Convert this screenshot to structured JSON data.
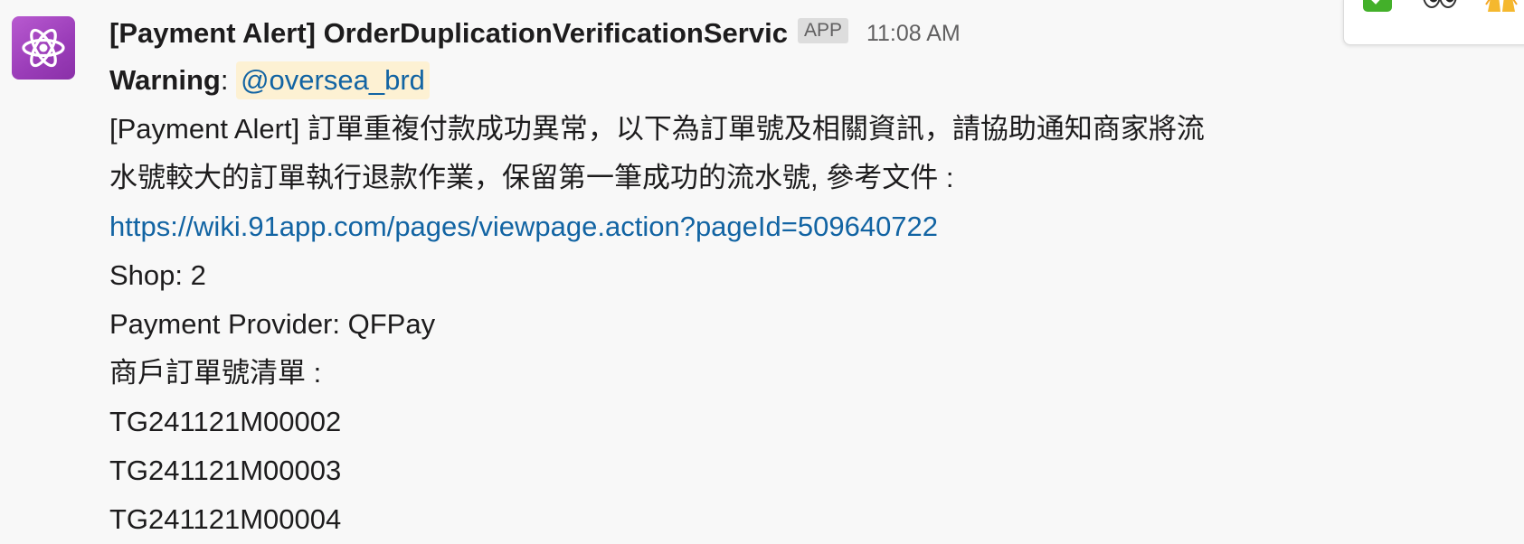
{
  "message": {
    "sender": "[Payment Alert] OrderDuplicationVerificationServic",
    "badge": "APP",
    "timestamp": "11:08 AM",
    "warning_label": "Warning",
    "mention": "@oversea_brd",
    "alert_line_1": "[Payment Alert] 訂單重複付款成功異常，以下為訂單號及相關資訊，請協助通知商家將流",
    "alert_line_2": "水號較大的訂單執行退款作業，保留第一筆成功的流水號, 參考文件 :",
    "link": "https://wiki.91app.com/pages/viewpage.action?pageId=509640722",
    "shop": "Shop: 2",
    "payment_provider": "Payment Provider: QFPay",
    "order_list_label": "商戶訂單號清單 :",
    "orders": [
      "TG241121M00002",
      "TG241121M00003",
      "TG241121M00004"
    ]
  },
  "avatar": {
    "icon": "atom-icon",
    "color": "#a046c4"
  },
  "reactions": [
    {
      "icon": "check-mark-icon",
      "color": "#43b02a"
    },
    {
      "icon": "eyes-icon",
      "color": "#333333"
    },
    {
      "icon": "raised-hands-icon",
      "color": "#f5b82e"
    }
  ],
  "colors": {
    "link": "#1264a3",
    "mention_bg": "#fdf1d3",
    "background": "#f8f8f8"
  }
}
